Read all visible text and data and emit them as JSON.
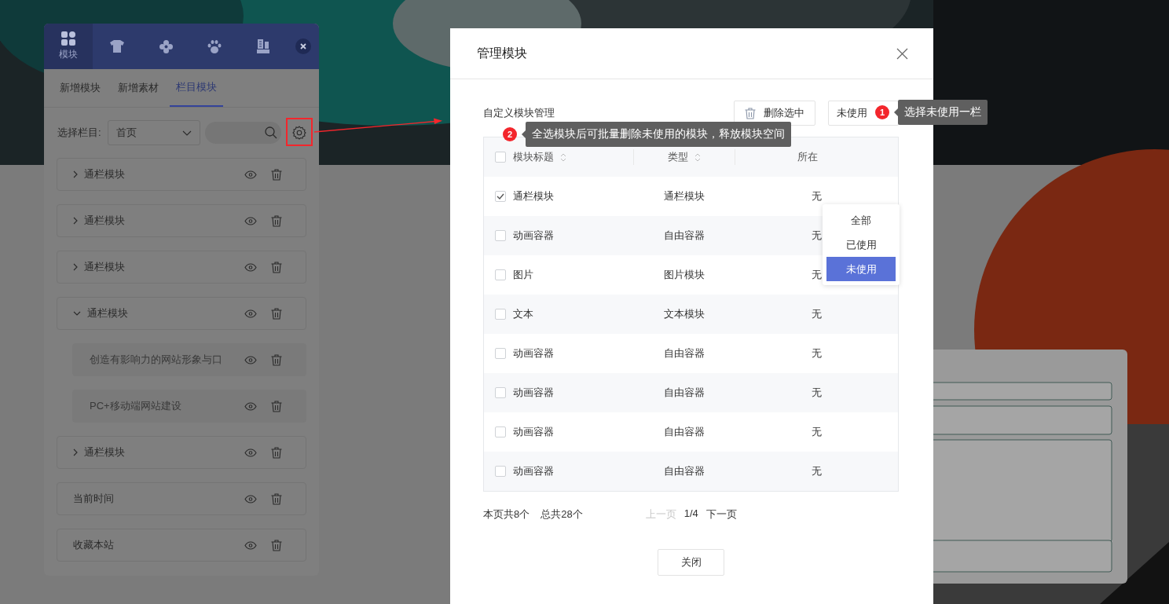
{
  "side_panel": {
    "tabs": [
      {
        "kind": "grid",
        "label": "模块",
        "selected": true
      },
      {
        "kind": "shirt",
        "selected": false
      },
      {
        "kind": "flower",
        "selected": false
      },
      {
        "kind": "paw",
        "selected": false
      },
      {
        "kind": "building",
        "selected": false
      }
    ],
    "subtabs": [
      {
        "label": "新增模块",
        "selected": false
      },
      {
        "label": "新增素材",
        "selected": false
      },
      {
        "label": "栏目模块",
        "selected": true
      }
    ],
    "column_label": "选择栏目:",
    "column_select": "首页",
    "items": [
      {
        "kind": "group",
        "label": "通栏模块",
        "expanded": false
      },
      {
        "kind": "group",
        "label": "通栏模块",
        "expanded": false
      },
      {
        "kind": "group",
        "label": "通栏模块",
        "expanded": false
      },
      {
        "kind": "group",
        "label": "通栏模块",
        "expanded": true,
        "children": [
          {
            "label": "创造有影响力的网站形象与口"
          },
          {
            "label": "PC+移动端网站建设"
          }
        ]
      },
      {
        "kind": "group",
        "label": "通栏模块",
        "expanded": false
      },
      {
        "kind": "plain",
        "label": "当前时间"
      },
      {
        "kind": "plain",
        "label": "收藏本站"
      }
    ]
  },
  "dialog": {
    "title": "管理模块",
    "section_title": "自定义模块管理",
    "delete_button": "删除选中",
    "filter": {
      "value": "未使用",
      "options": [
        {
          "label": "全部",
          "selected": false
        },
        {
          "label": "已使用",
          "selected": false
        },
        {
          "label": "未使用",
          "selected": true
        }
      ]
    },
    "table": {
      "select_all": false,
      "columns": [
        {
          "label": "模块标题",
          "sortable": true
        },
        {
          "label": "类型",
          "sortable": true
        },
        {
          "label": "所在",
          "sortable": false
        }
      ],
      "rows": [
        {
          "checked": true,
          "title": "通栏模块",
          "type": "通栏模块",
          "location": "无"
        },
        {
          "checked": false,
          "title": "动画容器",
          "type": "自由容器",
          "location": "无"
        },
        {
          "checked": false,
          "title": "图片",
          "type": "图片模块",
          "location": "无"
        },
        {
          "checked": false,
          "title": "文本",
          "type": "文本模块",
          "location": "无"
        },
        {
          "checked": false,
          "title": "动画容器",
          "type": "自由容器",
          "location": "无"
        },
        {
          "checked": false,
          "title": "动画容器",
          "type": "自由容器",
          "location": "无"
        },
        {
          "checked": false,
          "title": "动画容器",
          "type": "自由容器",
          "location": "无"
        },
        {
          "checked": false,
          "title": "动画容器",
          "type": "自由容器",
          "location": "无"
        }
      ]
    },
    "page_count": "本页共8个",
    "total_count": "总共28个",
    "pager": {
      "prev": {
        "label": "上一页",
        "disabled": true
      },
      "page": "1/4",
      "next": {
        "label": "下一页",
        "disabled": false
      }
    },
    "close_button": "关闭"
  },
  "annotations": [
    {
      "number": "1",
      "text": "选择未使用一栏"
    },
    {
      "number": "2",
      "text": "全选模块后可批量删除未使用的模块，释放模块空间"
    }
  ]
}
